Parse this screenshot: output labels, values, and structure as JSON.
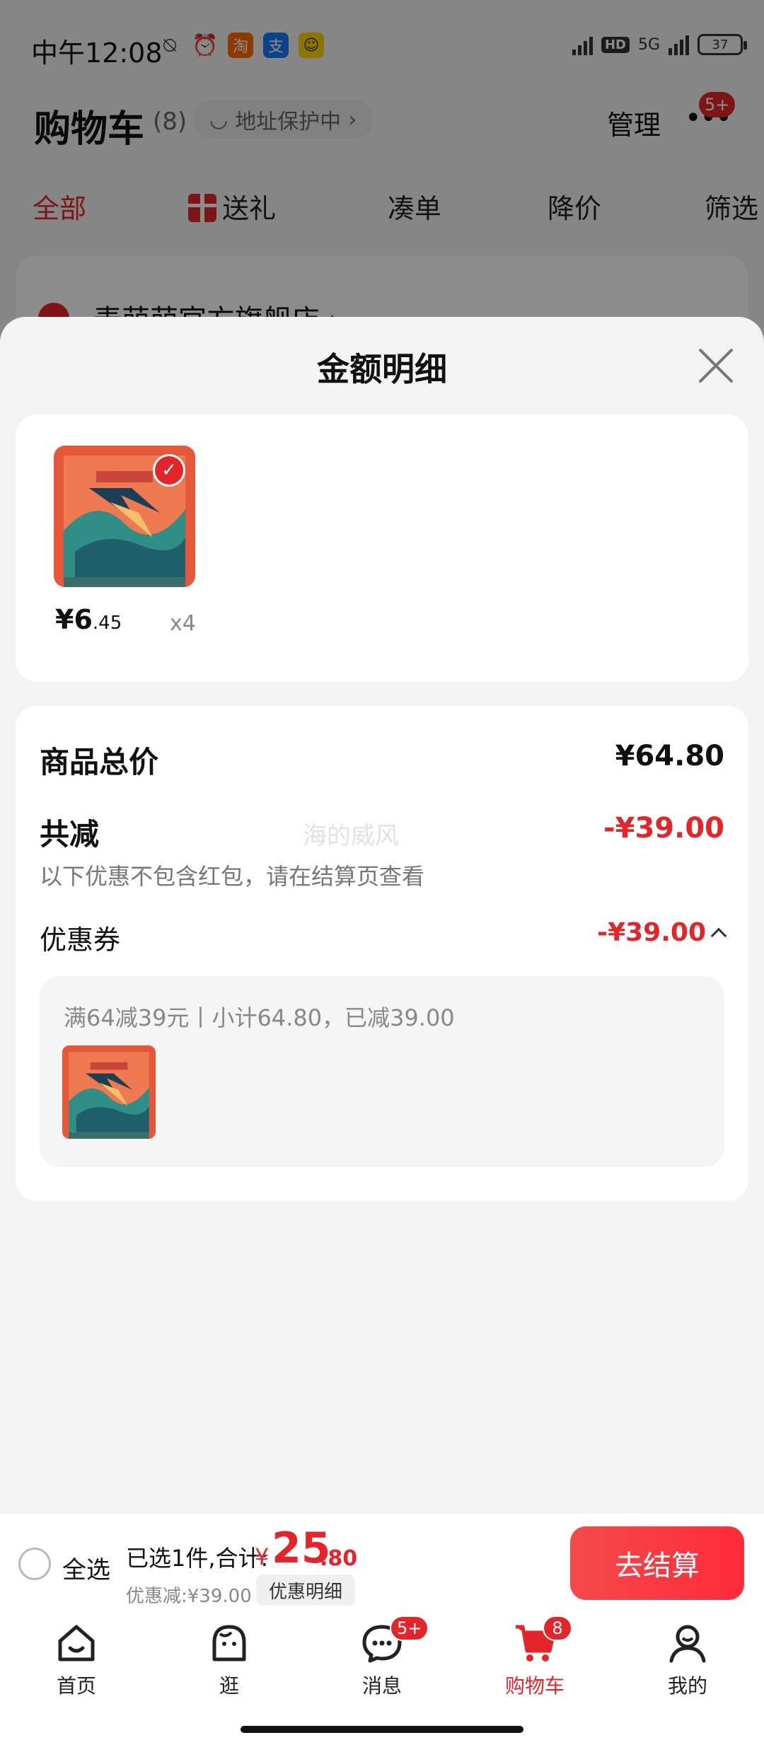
{
  "status_bar": {
    "time": "中午12:08",
    "app_icons": [
      "bell-muted-icon",
      "alarm-icon",
      "taobao-icon",
      "alipay-icon",
      "game-icon"
    ],
    "hd": "HD",
    "network": "5G",
    "battery": "37"
  },
  "header": {
    "title": "购物车",
    "count": "(8)",
    "address_protect": "地址保护中",
    "manage": "管理",
    "more_badge": "5+"
  },
  "filter_tabs": [
    {
      "label": "全部",
      "active": true
    },
    {
      "label": "送礼",
      "active": false
    },
    {
      "label": "凑单",
      "active": false
    },
    {
      "label": "降价",
      "active": false
    },
    {
      "label": "筛选",
      "active": false
    }
  ],
  "store": {
    "name": "麦萌萌官方旗舰店 ›"
  },
  "sheet": {
    "title": "金额明细",
    "product": {
      "price_int": "¥6",
      "price_dec": ".45",
      "qty": "x4"
    },
    "total_label": "商品总价",
    "total_value": "¥64.80",
    "reduce_label": "共减",
    "reduce_value": "-¥39.00",
    "note": "以下优惠不包含红包，请在结算页查看",
    "watermark": "海的威风",
    "coupon_label": "优惠券",
    "coupon_value": "-¥39.00",
    "coupon_desc": "满64减39元丨小计64.80，已减39.00"
  },
  "checkout": {
    "select_all": "全选",
    "summary": "已选1件,合计:",
    "yen": "¥",
    "total_int": "25",
    "total_dec": ".80",
    "discount": "优惠减:¥39.00",
    "detail_chip": "优惠明细",
    "button": "去结算"
  },
  "bottom_nav": [
    {
      "label": "首页",
      "icon": "home-icon",
      "badge": ""
    },
    {
      "label": "逛",
      "icon": "browse-icon",
      "badge": ""
    },
    {
      "label": "消息",
      "icon": "message-icon",
      "badge": "5+"
    },
    {
      "label": "购物车",
      "icon": "cart-icon",
      "badge": "8",
      "active": true
    },
    {
      "label": "我的",
      "icon": "profile-icon",
      "badge": ""
    }
  ],
  "colors": {
    "accent": "#e3252a",
    "sheet_bg": "#f3f3f3",
    "card_bg": "#ffffff"
  }
}
